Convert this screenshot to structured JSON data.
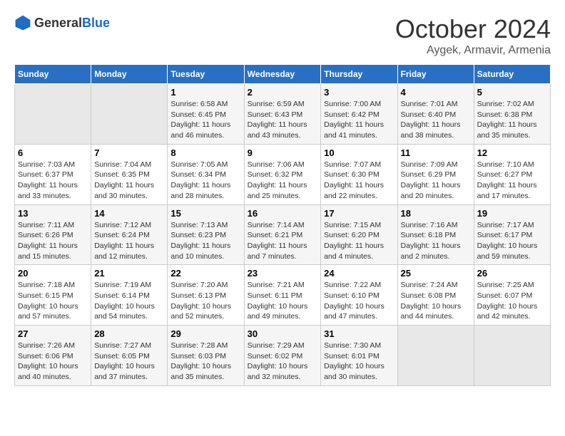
{
  "logo": {
    "general": "General",
    "blue": "Blue"
  },
  "header": {
    "month": "October 2024",
    "location": "Aygek, Armavir, Armenia"
  },
  "weekdays": [
    "Sunday",
    "Monday",
    "Tuesday",
    "Wednesday",
    "Thursday",
    "Friday",
    "Saturday"
  ],
  "weeks": [
    [
      {
        "day": "",
        "sunrise": "",
        "sunset": "",
        "daylight": ""
      },
      {
        "day": "",
        "sunrise": "",
        "sunset": "",
        "daylight": ""
      },
      {
        "day": "1",
        "sunrise": "Sunrise: 6:58 AM",
        "sunset": "Sunset: 6:45 PM",
        "daylight": "Daylight: 11 hours and 46 minutes."
      },
      {
        "day": "2",
        "sunrise": "Sunrise: 6:59 AM",
        "sunset": "Sunset: 6:43 PM",
        "daylight": "Daylight: 11 hours and 43 minutes."
      },
      {
        "day": "3",
        "sunrise": "Sunrise: 7:00 AM",
        "sunset": "Sunset: 6:42 PM",
        "daylight": "Daylight: 11 hours and 41 minutes."
      },
      {
        "day": "4",
        "sunrise": "Sunrise: 7:01 AM",
        "sunset": "Sunset: 6:40 PM",
        "daylight": "Daylight: 11 hours and 38 minutes."
      },
      {
        "day": "5",
        "sunrise": "Sunrise: 7:02 AM",
        "sunset": "Sunset: 6:38 PM",
        "daylight": "Daylight: 11 hours and 35 minutes."
      }
    ],
    [
      {
        "day": "6",
        "sunrise": "Sunrise: 7:03 AM",
        "sunset": "Sunset: 6:37 PM",
        "daylight": "Daylight: 11 hours and 33 minutes."
      },
      {
        "day": "7",
        "sunrise": "Sunrise: 7:04 AM",
        "sunset": "Sunset: 6:35 PM",
        "daylight": "Daylight: 11 hours and 30 minutes."
      },
      {
        "day": "8",
        "sunrise": "Sunrise: 7:05 AM",
        "sunset": "Sunset: 6:34 PM",
        "daylight": "Daylight: 11 hours and 28 minutes."
      },
      {
        "day": "9",
        "sunrise": "Sunrise: 7:06 AM",
        "sunset": "Sunset: 6:32 PM",
        "daylight": "Daylight: 11 hours and 25 minutes."
      },
      {
        "day": "10",
        "sunrise": "Sunrise: 7:07 AM",
        "sunset": "Sunset: 6:30 PM",
        "daylight": "Daylight: 11 hours and 22 minutes."
      },
      {
        "day": "11",
        "sunrise": "Sunrise: 7:09 AM",
        "sunset": "Sunset: 6:29 PM",
        "daylight": "Daylight: 11 hours and 20 minutes."
      },
      {
        "day": "12",
        "sunrise": "Sunrise: 7:10 AM",
        "sunset": "Sunset: 6:27 PM",
        "daylight": "Daylight: 11 hours and 17 minutes."
      }
    ],
    [
      {
        "day": "13",
        "sunrise": "Sunrise: 7:11 AM",
        "sunset": "Sunset: 6:26 PM",
        "daylight": "Daylight: 11 hours and 15 minutes."
      },
      {
        "day": "14",
        "sunrise": "Sunrise: 7:12 AM",
        "sunset": "Sunset: 6:24 PM",
        "daylight": "Daylight: 11 hours and 12 minutes."
      },
      {
        "day": "15",
        "sunrise": "Sunrise: 7:13 AM",
        "sunset": "Sunset: 6:23 PM",
        "daylight": "Daylight: 11 hours and 10 minutes."
      },
      {
        "day": "16",
        "sunrise": "Sunrise: 7:14 AM",
        "sunset": "Sunset: 6:21 PM",
        "daylight": "Daylight: 11 hours and 7 minutes."
      },
      {
        "day": "17",
        "sunrise": "Sunrise: 7:15 AM",
        "sunset": "Sunset: 6:20 PM",
        "daylight": "Daylight: 11 hours and 4 minutes."
      },
      {
        "day": "18",
        "sunrise": "Sunrise: 7:16 AM",
        "sunset": "Sunset: 6:18 PM",
        "daylight": "Daylight: 11 hours and 2 minutes."
      },
      {
        "day": "19",
        "sunrise": "Sunrise: 7:17 AM",
        "sunset": "Sunset: 6:17 PM",
        "daylight": "Daylight: 10 hours and 59 minutes."
      }
    ],
    [
      {
        "day": "20",
        "sunrise": "Sunrise: 7:18 AM",
        "sunset": "Sunset: 6:15 PM",
        "daylight": "Daylight: 10 hours and 57 minutes."
      },
      {
        "day": "21",
        "sunrise": "Sunrise: 7:19 AM",
        "sunset": "Sunset: 6:14 PM",
        "daylight": "Daylight: 10 hours and 54 minutes."
      },
      {
        "day": "22",
        "sunrise": "Sunrise: 7:20 AM",
        "sunset": "Sunset: 6:13 PM",
        "daylight": "Daylight: 10 hours and 52 minutes."
      },
      {
        "day": "23",
        "sunrise": "Sunrise: 7:21 AM",
        "sunset": "Sunset: 6:11 PM",
        "daylight": "Daylight: 10 hours and 49 minutes."
      },
      {
        "day": "24",
        "sunrise": "Sunrise: 7:22 AM",
        "sunset": "Sunset: 6:10 PM",
        "daylight": "Daylight: 10 hours and 47 minutes."
      },
      {
        "day": "25",
        "sunrise": "Sunrise: 7:24 AM",
        "sunset": "Sunset: 6:08 PM",
        "daylight": "Daylight: 10 hours and 44 minutes."
      },
      {
        "day": "26",
        "sunrise": "Sunrise: 7:25 AM",
        "sunset": "Sunset: 6:07 PM",
        "daylight": "Daylight: 10 hours and 42 minutes."
      }
    ],
    [
      {
        "day": "27",
        "sunrise": "Sunrise: 7:26 AM",
        "sunset": "Sunset: 6:06 PM",
        "daylight": "Daylight: 10 hours and 40 minutes."
      },
      {
        "day": "28",
        "sunrise": "Sunrise: 7:27 AM",
        "sunset": "Sunset: 6:05 PM",
        "daylight": "Daylight: 10 hours and 37 minutes."
      },
      {
        "day": "29",
        "sunrise": "Sunrise: 7:28 AM",
        "sunset": "Sunset: 6:03 PM",
        "daylight": "Daylight: 10 hours and 35 minutes."
      },
      {
        "day": "30",
        "sunrise": "Sunrise: 7:29 AM",
        "sunset": "Sunset: 6:02 PM",
        "daylight": "Daylight: 10 hours and 32 minutes."
      },
      {
        "day": "31",
        "sunrise": "Sunrise: 7:30 AM",
        "sunset": "Sunset: 6:01 PM",
        "daylight": "Daylight: 10 hours and 30 minutes."
      },
      {
        "day": "",
        "sunrise": "",
        "sunset": "",
        "daylight": ""
      },
      {
        "day": "",
        "sunrise": "",
        "sunset": "",
        "daylight": ""
      }
    ]
  ]
}
